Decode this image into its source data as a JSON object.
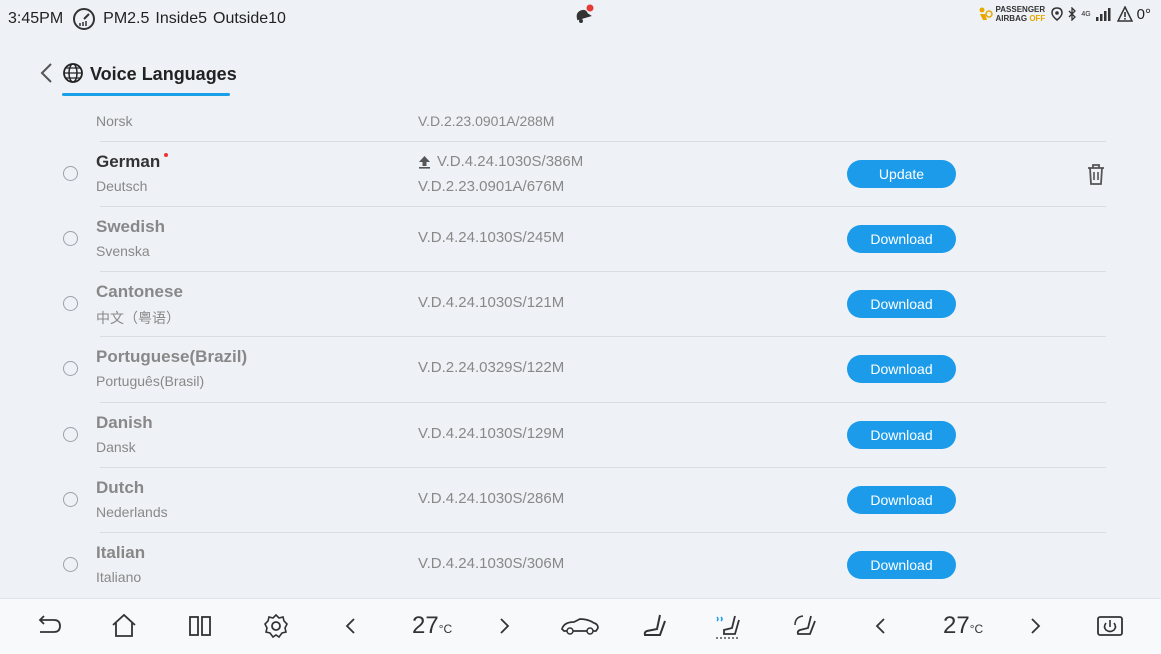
{
  "status": {
    "time": "3:45PM",
    "pm_label": "PM2.5",
    "inside_label": "Inside",
    "inside_value": "5",
    "outside_label": "Outside",
    "outside_value": "10",
    "airbag_line1": "PASSENGER",
    "airbag_line2": "AIRBAG",
    "airbag_off": "OFF",
    "signal_label": "4G",
    "alert_value": "0",
    "alert_unit": "°"
  },
  "header": {
    "title": "Voice Languages"
  },
  "partial_row": {
    "name": "Norsk",
    "version": "V.D.2.23.0901A/288M"
  },
  "languages": [
    {
      "name": "German",
      "native": "Deutsch",
      "version_new": "V.D.4.24.1030S/386M",
      "version_old": "V.D.2.23.0901A/676M",
      "action": "Update"
    },
    {
      "name": "Swedish",
      "native": "Svenska",
      "version": "V.D.4.24.1030S/245M",
      "action": "Download"
    },
    {
      "name": "Cantonese",
      "native": "中文（粤语）",
      "version": "V.D.4.24.1030S/121M",
      "action": "Download"
    },
    {
      "name": "Portuguese(Brazil)",
      "native": "Português(Brasil)",
      "version": "V.D.2.24.0329S/122M",
      "action": "Download"
    },
    {
      "name": "Danish",
      "native": "Dansk",
      "version": "V.D.4.24.1030S/129M",
      "action": "Download"
    },
    {
      "name": "Dutch",
      "native": "Nederlands",
      "version": "V.D.4.24.1030S/286M",
      "action": "Download"
    },
    {
      "name": "Italian",
      "native": "Italiano",
      "version": "V.D.4.24.1030S/306M",
      "action": "Download"
    }
  ],
  "climate": {
    "left_temp": "27",
    "right_temp": "27",
    "unit": "°C"
  },
  "colors": {
    "accent": "#1b9be9"
  },
  "icons": [
    "back-icon",
    "home-icon",
    "split-screen-icon",
    "settings-icon",
    "car-icon",
    "seat-icon",
    "seat-heat-icon",
    "recirculation-icon",
    "power-icon",
    "globe-icon",
    "trash-icon"
  ]
}
